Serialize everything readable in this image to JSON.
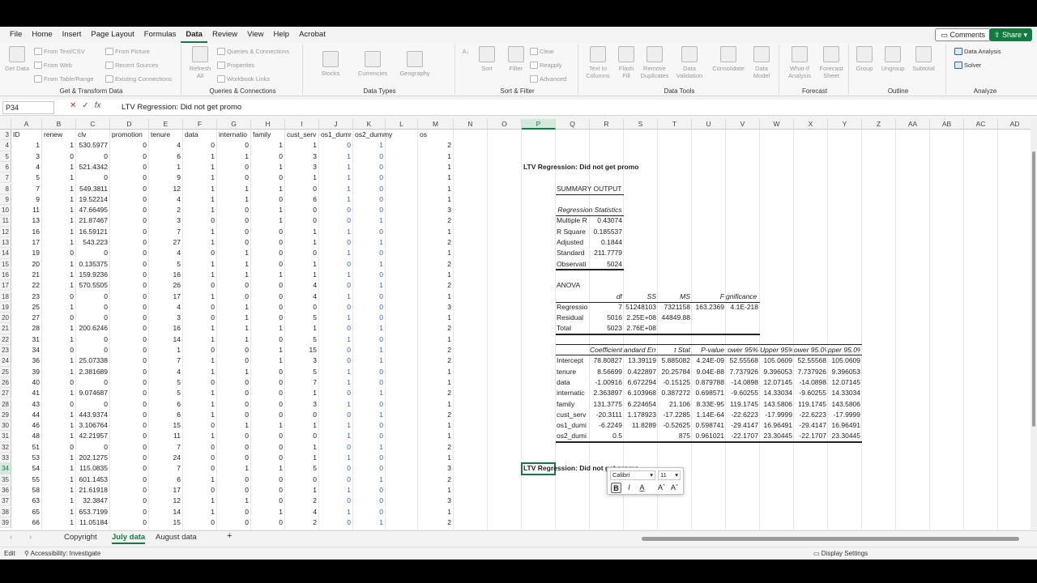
{
  "menu": {
    "items": [
      "File",
      "Home",
      "Insert",
      "Page Layout",
      "Formulas",
      "Data",
      "Review",
      "View",
      "Help",
      "Acrobat"
    ],
    "comments": "Comments",
    "share": "Share"
  },
  "ribbon": {
    "get_transform": {
      "get_data": "Get Data",
      "from_text": "From Text/CSV",
      "from_web": "From Web",
      "from_table": "From Table/Range",
      "from_picture": "From Picture",
      "recent": "Recent Sources",
      "existing": "Existing Connections",
      "label": "Get & Transform Data"
    },
    "queries": {
      "refresh": "Refresh All",
      "qc": "Queries & Connections",
      "props": "Properties",
      "links": "Workbook Links",
      "label": "Queries & Connections"
    },
    "types": {
      "stocks": "Stocks",
      "currencies": "Currencies",
      "geography": "Geography",
      "label": "Data Types"
    },
    "sort": {
      "sort": "Sort",
      "filter": "Filter",
      "clear": "Clear",
      "reapply": "Reapply",
      "advanced": "Advanced",
      "label": "Sort & Filter"
    },
    "tools": {
      "t2c": "Text to Columns",
      "flash": "Flash Fill",
      "remdup": "Remove Duplicates",
      "valid": "Data Validation",
      "consol": "Consolidate",
      "model": "Data Model",
      "label": "Data Tools"
    },
    "forecast": {
      "whatif": "What-If Analysis",
      "sheet": "Forecast Sheet",
      "label": "Forecast"
    },
    "outline": {
      "group": "Group",
      "ungroup": "Ungroup",
      "subtotal": "Subtotal",
      "label": "Outline"
    },
    "analyze": {
      "da": "Data Analysis",
      "solver": "Solver",
      "label": "Analyze"
    }
  },
  "formula": {
    "namebox": "P34",
    "content": "LTV Regression: Did not get promo"
  },
  "columns": [
    "A",
    "B",
    "C",
    "D",
    "E",
    "F",
    "G",
    "H",
    "I",
    "J",
    "K",
    "L",
    "M",
    "N",
    "O",
    "P",
    "Q",
    "R",
    "S",
    "T",
    "U",
    "V",
    "W",
    "X",
    "Y",
    "Z",
    "AA",
    "AB",
    "AC",
    "AD"
  ],
  "rows": [
    "3",
    "4",
    "5",
    "6",
    "7",
    "8",
    "9",
    "10",
    "11",
    "12",
    "13",
    "14",
    "15",
    "16",
    "17",
    "18",
    "19",
    "20",
    "21",
    "22",
    "23",
    "24",
    "25",
    "26",
    "27",
    "28",
    "29",
    "30",
    "31",
    "32",
    "33",
    "34",
    "35",
    "36",
    "37",
    "38",
    "39"
  ],
  "headers": [
    "ID",
    "renew",
    "clv",
    "promotion",
    "tenure",
    "data",
    "internatio",
    "family",
    "cust_serv",
    "os1_dumr",
    "os2_dummy",
    "",
    "os"
  ],
  "data": [
    [
      "1",
      "1",
      "530.5977",
      "0",
      "4",
      "0",
      "0",
      "1",
      "1",
      "0",
      "1",
      "",
      "2"
    ],
    [
      "3",
      "0",
      "0",
      "0",
      "6",
      "1",
      "1",
      "0",
      "3",
      "1",
      "0",
      "",
      "1"
    ],
    [
      "4",
      "1",
      "521.4342",
      "0",
      "1",
      "1",
      "0",
      "1",
      "3",
      "1",
      "0",
      "",
      "1"
    ],
    [
      "5",
      "1",
      "0",
      "0",
      "9",
      "1",
      "0",
      "0",
      "1",
      "1",
      "0",
      "",
      "1"
    ],
    [
      "7",
      "1",
      "549.3811",
      "0",
      "12",
      "1",
      "1",
      "1",
      "0",
      "1",
      "0",
      "",
      "1"
    ],
    [
      "9",
      "1",
      "19.52214",
      "0",
      "4",
      "1",
      "1",
      "0",
      "6",
      "1",
      "0",
      "",
      "1"
    ],
    [
      "11",
      "1",
      "47.66495",
      "0",
      "2",
      "1",
      "0",
      "1",
      "0",
      "0",
      "0",
      "",
      "3"
    ],
    [
      "13",
      "1",
      "21.87467",
      "0",
      "3",
      "0",
      "0",
      "1",
      "0",
      "0",
      "1",
      "",
      "2"
    ],
    [
      "16",
      "1",
      "16.59121",
      "0",
      "7",
      "1",
      "0",
      "0",
      "1",
      "1",
      "0",
      "",
      "1"
    ],
    [
      "17",
      "1",
      "543.223",
      "0",
      "27",
      "1",
      "0",
      "0",
      "1",
      "0",
      "1",
      "",
      "2"
    ],
    [
      "19",
      "0",
      "0",
      "0",
      "4",
      "0",
      "1",
      "0",
      "0",
      "1",
      "0",
      "",
      "1"
    ],
    [
      "20",
      "1",
      "0.135375",
      "0",
      "5",
      "1",
      "1",
      "0",
      "1",
      "0",
      "1",
      "",
      "2"
    ],
    [
      "21",
      "1",
      "159.9236",
      "0",
      "16",
      "1",
      "1",
      "1",
      "1",
      "1",
      "0",
      "",
      "1"
    ],
    [
      "22",
      "1",
      "570.5505",
      "0",
      "26",
      "0",
      "0",
      "0",
      "4",
      "0",
      "1",
      "",
      "2"
    ],
    [
      "23",
      "0",
      "0",
      "0",
      "17",
      "1",
      "0",
      "0",
      "4",
      "1",
      "0",
      "",
      "1"
    ],
    [
      "25",
      "1",
      "0",
      "0",
      "4",
      "0",
      "1",
      "0",
      "0",
      "0",
      "0",
      "",
      "3"
    ],
    [
      "27",
      "0",
      "0",
      "0",
      "3",
      "0",
      "1",
      "0",
      "5",
      "1",
      "0",
      "",
      "1"
    ],
    [
      "28",
      "1",
      "200.6246",
      "0",
      "16",
      "1",
      "1",
      "1",
      "1",
      "0",
      "1",
      "",
      "2"
    ],
    [
      "31",
      "1",
      "0",
      "0",
      "14",
      "1",
      "1",
      "0",
      "5",
      "1",
      "0",
      "",
      "1"
    ],
    [
      "34",
      "0",
      "0",
      "0",
      "1",
      "0",
      "0",
      "1",
      "15",
      "0",
      "1",
      "",
      "2"
    ],
    [
      "36",
      "1",
      "25.07338",
      "0",
      "7",
      "1",
      "0",
      "1",
      "3",
      "0",
      "1",
      "",
      "2"
    ],
    [
      "39",
      "1",
      "2.381689",
      "0",
      "4",
      "1",
      "1",
      "0",
      "5",
      "1",
      "0",
      "",
      "1"
    ],
    [
      "40",
      "0",
      "0",
      "0",
      "5",
      "0",
      "0",
      "0",
      "7",
      "1",
      "0",
      "",
      "1"
    ],
    [
      "41",
      "1",
      "9.074687",
      "0",
      "5",
      "1",
      "0",
      "0",
      "1",
      "0",
      "1",
      "",
      "2"
    ],
    [
      "43",
      "0",
      "0",
      "0",
      "6",
      "1",
      "0",
      "0",
      "3",
      "1",
      "0",
      "",
      "1"
    ],
    [
      "44",
      "1",
      "443.9374",
      "0",
      "6",
      "1",
      "0",
      "0",
      "0",
      "0",
      "1",
      "",
      "2"
    ],
    [
      "46",
      "1",
      "3.106764",
      "0",
      "15",
      "0",
      "1",
      "1",
      "1",
      "1",
      "0",
      "",
      "1"
    ],
    [
      "48",
      "1",
      "42.21957",
      "0",
      "11",
      "1",
      "0",
      "0",
      "0",
      "1",
      "0",
      "",
      "1"
    ],
    [
      "51",
      "0",
      "0",
      "0",
      "7",
      "0",
      "0",
      "0",
      "1",
      "0",
      "1",
      "",
      "2"
    ],
    [
      "53",
      "1",
      "202.1275",
      "0",
      "24",
      "0",
      "0",
      "0",
      "1",
      "1",
      "0",
      "",
      "1"
    ],
    [
      "54",
      "1",
      "115.0835",
      "0",
      "7",
      "0",
      "1",
      "1",
      "5",
      "0",
      "0",
      "",
      "3"
    ],
    [
      "55",
      "1",
      "601.1453",
      "0",
      "6",
      "1",
      "0",
      "0",
      "0",
      "0",
      "1",
      "",
      "2"
    ],
    [
      "58",
      "1",
      "21.61918",
      "0",
      "17",
      "0",
      "0",
      "0",
      "1",
      "1",
      "0",
      "",
      "1"
    ],
    [
      "63",
      "1",
      "32.3847",
      "0",
      "12",
      "1",
      "1",
      "0",
      "2",
      "0",
      "0",
      "",
      "3"
    ],
    [
      "65",
      "1",
      "653.7199",
      "0",
      "14",
      "1",
      "0",
      "1",
      "4",
      "1",
      "0",
      "",
      "1"
    ],
    [
      "66",
      "1",
      "11.05184",
      "0",
      "15",
      "0",
      "0",
      "0",
      "2",
      "0",
      "1",
      "",
      "2"
    ]
  ],
  "regression": {
    "title": "LTV Regression: Did not get promo",
    "summary": "SUMMARY OUTPUT",
    "stats_header": "Regression Statistics",
    "stats": [
      [
        "Multiple R",
        "0.43074"
      ],
      [
        "R Square",
        "0.185537"
      ],
      [
        "Adjusted",
        "0.1844"
      ],
      [
        "Standard",
        "211.7779"
      ],
      [
        "Observati",
        "5024"
      ]
    ],
    "anova_label": "ANOVA",
    "anova_header": [
      "",
      "df",
      "SS",
      "MS",
      "F",
      "gnificance F"
    ],
    "anova": [
      [
        "Regressio",
        "7",
        "51248103",
        "7321158",
        "163.2369",
        "4.1E-218"
      ],
      [
        "Residual",
        "5016",
        "2.25E+08",
        "44849.88",
        "",
        ""
      ],
      [
        "Total",
        "5023",
        "2.76E+08",
        "",
        "",
        ""
      ]
    ],
    "coef_header": [
      "",
      "Coefficients",
      "andard Err",
      "t Stat",
      "P-value",
      "ower 95%",
      "Upper 95%",
      "ower 95.0%",
      "pper 95.0%"
    ],
    "coef": [
      [
        "Intercept",
        "78.80827",
        "13.39119",
        "5.885082",
        "4.24E-09",
        "52.55568",
        "105.0609",
        "52.55568",
        "105.0609"
      ],
      [
        "tenure",
        "8.56699",
        "0.422897",
        "20.25784",
        "9.04E-88",
        "7.737926",
        "9.396053",
        "7.737926",
        "9.396053"
      ],
      [
        "data",
        "-1.00916",
        "6.672294",
        "-0.15125",
        "0.879788",
        "-14.0898",
        "12.07145",
        "-14.0898",
        "12.07145"
      ],
      [
        "internatic",
        "2.363897",
        "6.103968",
        "0.387272",
        "0.698571",
        "-9.60255",
        "14.33034",
        "-9.60255",
        "14.33034"
      ],
      [
        "family",
        "131.3775",
        "6.224654",
        "21.106",
        "8.33E-95",
        "119.1745",
        "143.5806",
        "119.1745",
        "143.5806"
      ],
      [
        "cust_serv",
        "-20.3111",
        "1.178923",
        "-17.2285",
        "1.14E-64",
        "-22.6223",
        "-17.9999",
        "-22.6223",
        "-17.9999"
      ],
      [
        "os1_dumi",
        "-6.2249",
        "11.8289",
        "-0.52625",
        "0.598741",
        "-29.4147",
        "16.96491",
        "-29.4147",
        "16.96491"
      ],
      [
        "os2_dumi",
        "0.5",
        "",
        "875",
        "0.961021",
        "-22.1707",
        "23.30445",
        "-22.1707",
        "23.30445"
      ]
    ],
    "repeat_title": "LTV Regression: Did not get promo"
  },
  "minitoolbar": {
    "font": "Calibri",
    "size": "11",
    "bold": "B",
    "italic": "I",
    "color": "A",
    "grow": "Aˆ",
    "shrink": "Aˇ"
  },
  "sheets": {
    "tabs": [
      "Copyright",
      "July data",
      "August data"
    ],
    "add": "+"
  },
  "status": {
    "mode": "Edit",
    "accessibility": "Accessibility: Investigate",
    "display": "Display Settings"
  }
}
